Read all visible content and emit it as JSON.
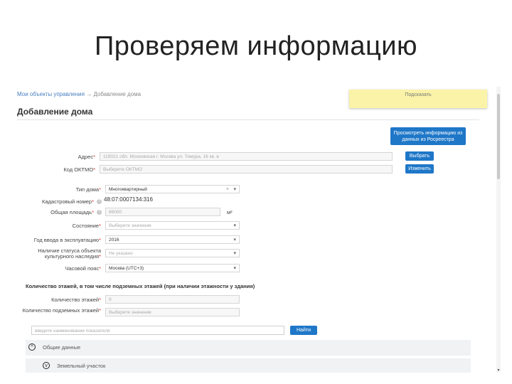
{
  "slide": {
    "title": "Проверяем информацию"
  },
  "breadcrumb": {
    "link1": "Мои объекты управления",
    "sep": "→",
    "current": "Добавление дома"
  },
  "sticky_note": {
    "text": "Подсказать"
  },
  "form": {
    "title": "Добавление дома",
    "rosreestr_button": "Просмотреть информацию из данных из Росреестра",
    "address": {
      "label": "Адрес",
      "value": "119021 обл. Московская г. Москва ул. Тимура, 16 кв. в"
    },
    "select_button": "Выбрать",
    "oktmo": {
      "label": "Код ОКТМО",
      "value": "Выберите ОКТМО"
    },
    "change_button": "Изменить",
    "house_type": {
      "label": "Тип дома",
      "value": "Многоквартирный",
      "clear": "×"
    },
    "cadastral": {
      "label": "Кадастровый номер",
      "value": "48:07:0007134:316"
    },
    "area": {
      "label": "Общая площадь",
      "value": "86000",
      "unit": "м²"
    },
    "condition": {
      "label": "Состояние",
      "value": "Выберите значение"
    },
    "year": {
      "label": "Год ввода в эксплуатацию",
      "value": "2016"
    },
    "cultural_status": {
      "label": "Наличие статуса объекта культурного наследия",
      "value": "Не указано"
    },
    "timezone": {
      "label": "Часовой пояс",
      "value": "Москва (UTC+3)"
    },
    "floors_section": {
      "title": "Количество этажей, в том числе подземных этажей (при наличии этажности у здания)"
    },
    "floors": {
      "label": "Количество этажей",
      "value": "9"
    },
    "underground": {
      "label": "Количество подземных этажей",
      "value": "Выберите значение"
    },
    "search": {
      "placeholder": "введите наименование показателя",
      "button": "Найти"
    },
    "accordion": [
      {
        "label": "Общие данные",
        "icon": "chevron-up-icon"
      },
      {
        "label": "Земельный участок",
        "icon": "chevron-down-icon"
      }
    ]
  }
}
